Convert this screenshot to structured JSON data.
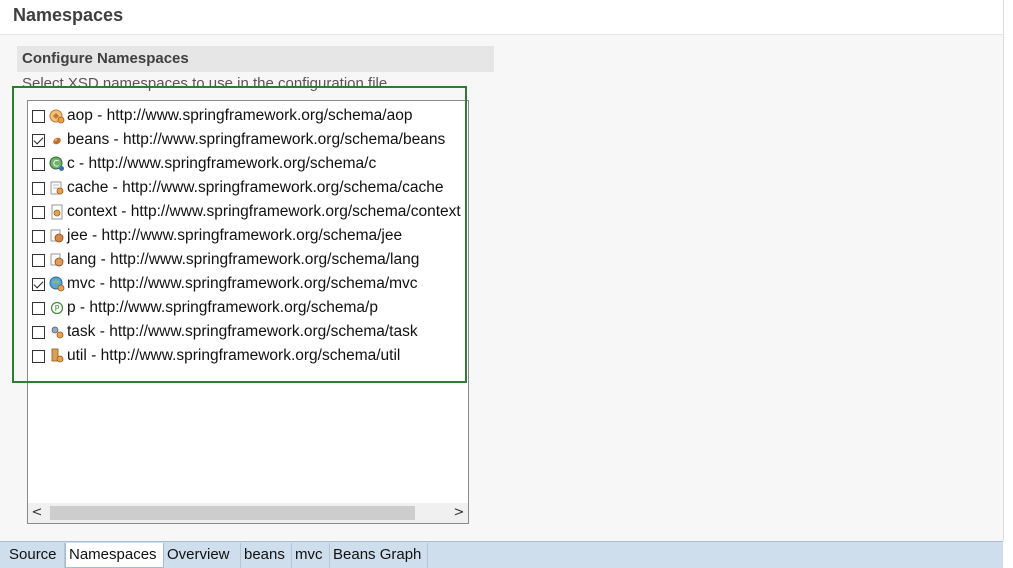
{
  "header": {
    "title": "Namespaces"
  },
  "section": {
    "title": "Configure Namespaces",
    "description": "Select XSD namespaces to use in the configuration file"
  },
  "namespaces": [
    {
      "label": "aop - http://www.springframework.org/schema/aop",
      "checked": false,
      "icon": "aop-icon"
    },
    {
      "label": "beans - http://www.springframework.org/schema/beans",
      "checked": true,
      "icon": "beans-icon"
    },
    {
      "label": "c - http://www.springframework.org/schema/c",
      "checked": false,
      "icon": "c-namespace-icon"
    },
    {
      "label": "cache - http://www.springframework.org/schema/cache",
      "checked": false,
      "icon": "cache-icon"
    },
    {
      "label": "context - http://www.springframework.org/schema/context",
      "checked": false,
      "icon": "context-icon"
    },
    {
      "label": "jee - http://www.springframework.org/schema/jee",
      "checked": false,
      "icon": "jee-icon"
    },
    {
      "label": "lang - http://www.springframework.org/schema/lang",
      "checked": false,
      "icon": "lang-icon"
    },
    {
      "label": "mvc - http://www.springframework.org/schema/mvc",
      "checked": true,
      "icon": "mvc-icon"
    },
    {
      "label": "p - http://www.springframework.org/schema/p",
      "checked": false,
      "icon": "p-namespace-icon"
    },
    {
      "label": "task - http://www.springframework.org/schema/task",
      "checked": false,
      "icon": "task-icon"
    },
    {
      "label": "util - http://www.springframework.org/schema/util",
      "checked": false,
      "icon": "util-icon"
    }
  ],
  "scroll": {
    "left": "<",
    "right": ">"
  },
  "tabs": [
    {
      "label": "Source",
      "active": false
    },
    {
      "label": "Namespaces",
      "active": true
    },
    {
      "label": "Overview",
      "active": false
    },
    {
      "label": "beans",
      "active": false
    },
    {
      "label": "mvc",
      "active": false
    },
    {
      "label": "Beans Graph",
      "active": false
    }
  ],
  "colors": {
    "highlight": "#2e7d32",
    "tabbar": "#cfdeec"
  }
}
